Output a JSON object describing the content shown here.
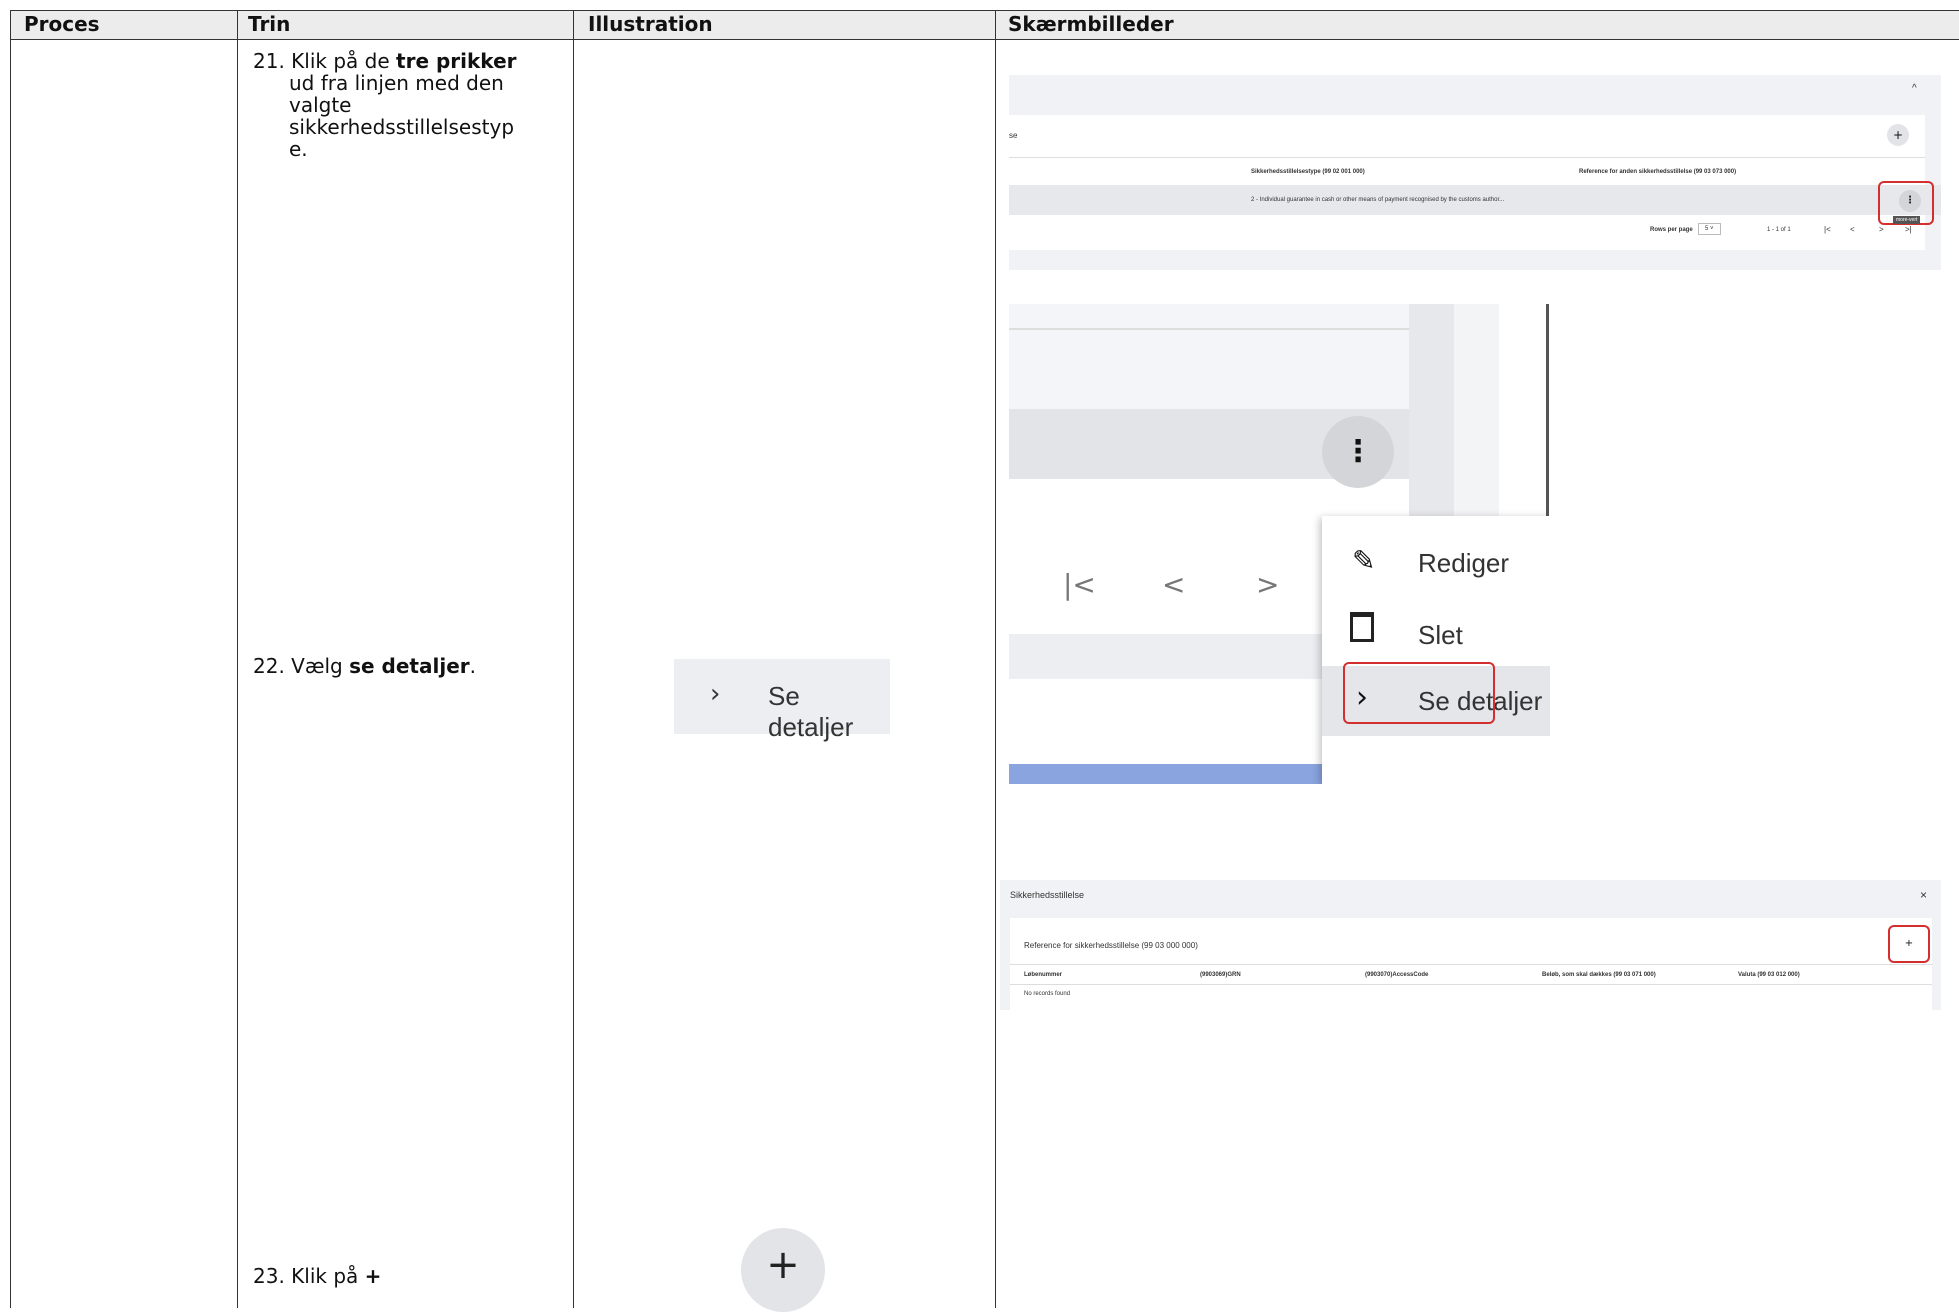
{
  "headers": [
    "Proces",
    "Trin",
    "Illustration",
    "Skærmbilleder"
  ],
  "steps": [
    {
      "num": "21.",
      "text_lines": [
        "Klik på de",
        "ud fra linjen med den",
        "valgte",
        "sikkerhedsstillelsestyp",
        "e."
      ],
      "bold": "tre prikker"
    },
    {
      "num": "22.",
      "pre": "Vælg ",
      "bold": "se detaljer",
      "post": "."
    },
    {
      "num": "23.",
      "pre": "Klik på ",
      "bold": "+"
    }
  ],
  "illustration": {
    "se_detaljer": "Se detaljer",
    "plus": "+"
  },
  "shot1": {
    "col1_header": "Sikkerhedsstillelsestype (99 02 001 000)",
    "col2_header": "Reference for anden sikkerhedsstillelse (99 03 073 000)",
    "row_value": "2 - Individual guarantee in cash or other means of payment recognised by the customs author...",
    "rows_per_page_label": "Rows per page",
    "rows_per_page_value": "5",
    "range": "1 - 1 of 1",
    "tooltip": "more-vert",
    "partial_title": "se"
  },
  "shot2": {
    "menu": [
      "Rediger",
      "Slet",
      "Se detaljer"
    ]
  },
  "shot3": {
    "title": "Sikkerhedsstillelse",
    "subtitle": "Reference for sikkerhedsstillelse (99 03 000 000)",
    "columns": [
      "Løbenummer",
      "(9903069)GRN",
      "(9903070)AccessCode",
      "Beløb, som skal dækkes (99 03 071 000)",
      "Valuta (99 03 012 000)"
    ],
    "empty": "No records found"
  },
  "colors": {
    "accent_red": "#d32f2f",
    "blue_bar": "#8aa4e0"
  }
}
